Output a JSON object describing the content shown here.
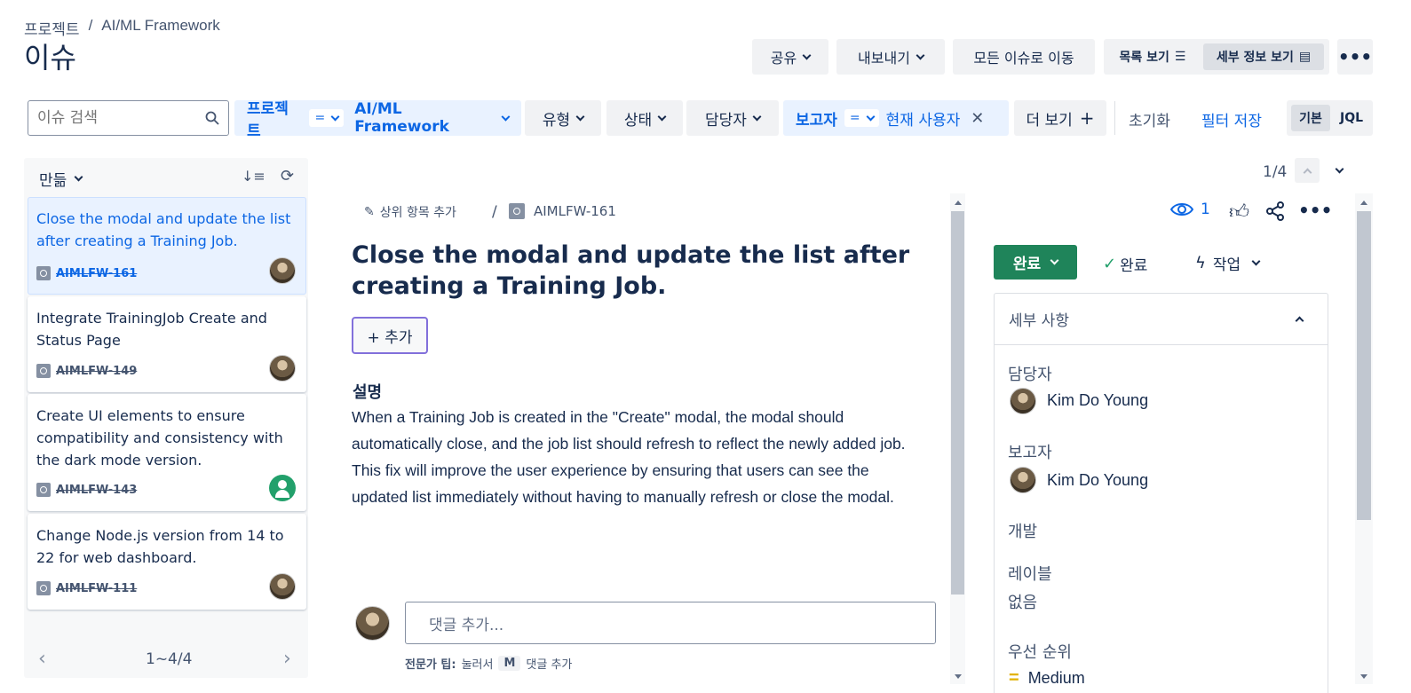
{
  "breadcrumb": {
    "parent": "프로젝트",
    "separator": "/",
    "current": "AI/ML Framework"
  },
  "page_title": "이슈",
  "header_actions": {
    "share": "공유",
    "export": "내보내기",
    "go_all": "모든 이슈로 이동",
    "list_view": "목록 보기",
    "detail_view": "세부 정보 보기"
  },
  "filters": {
    "search_placeholder": "이슈 검색",
    "project_label": "프로젝트",
    "project_op": "=",
    "project_value": "AI/ML Framework",
    "type": "유형",
    "status": "상태",
    "assignee": "담당자",
    "reporter_label": "보고자",
    "reporter_op": "=",
    "reporter_value": "현재 사용자",
    "more": "더 보기",
    "reset": "초기화",
    "save_filter": "필터 저장",
    "mode_basic": "기본",
    "mode_jql": "JQL"
  },
  "list_panel": {
    "sort_label": "만듦",
    "pagination": "1~4/4",
    "items": [
      {
        "title": "Close the modal and update the list after creating a Training Job.",
        "key": "AIMLFW-161"
      },
      {
        "title": "Integrate TrainingJob Create and Status Page",
        "key": "AIMLFW-149"
      },
      {
        "title": "Create UI elements to ensure compatibility and consistency with the dark mode version.",
        "key": "AIMLFW-143"
      },
      {
        "title": "Change Node.js version from 14 to 22 for web dashboard.",
        "key": "AIMLFW-111"
      }
    ]
  },
  "nav_counter": "1/4",
  "issue": {
    "add_parent": "상위 항목 추가",
    "separator": "/",
    "key": "AIMLFW-161",
    "title": "Close the modal and update the list after creating a Training Job.",
    "add_button": "+ 추가",
    "desc_heading": "설명",
    "description": "When a Training Job is created in the \"Create\" modal, the modal should automatically close, and the job list should refresh to reflect the newly added job. This fix will improve the user experience by ensuring that users can see the updated list immediately without having to manually refresh or close the modal.",
    "comment_placeholder": "댓글 추가...",
    "tip_bold": "전문가 팁:",
    "tip_text": "눌러서",
    "tip_key": "M",
    "tip_tail": "댓글 추가"
  },
  "side": {
    "watchers": "1",
    "status_button": "완료",
    "resolution": "완료",
    "action": "작업",
    "details_title": "세부 사항",
    "assignee_label": "담당자",
    "assignee_value": "Kim Do Young",
    "reporter_label": "보고자",
    "reporter_value": "Kim Do Young",
    "development_label": "개발",
    "labels_label": "레이블",
    "labels_value": "없음",
    "priority_label": "우선 순위",
    "priority_value": "Medium"
  },
  "colors": {
    "accent": "#0c66e4",
    "success": "#1f845a",
    "selected_bg": "#e9f2ff",
    "filter_bg": "#e9f2ff"
  }
}
